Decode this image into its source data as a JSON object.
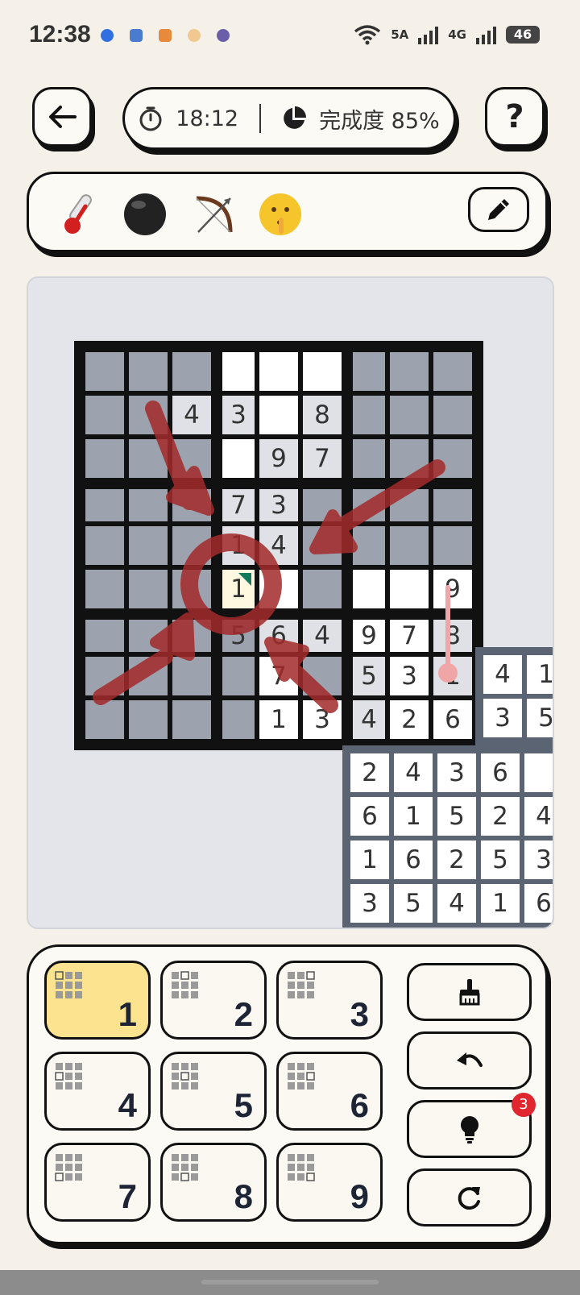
{
  "status_bar": {
    "time": "12:38",
    "net1": "5A",
    "net2": "4G",
    "battery": "46"
  },
  "header": {
    "back_icon": "arrow-left-icon",
    "timer": "18:12",
    "progress_text": "完成度 85%",
    "help_label": "?"
  },
  "tools": [
    "thermometer",
    "black-ball",
    "bow-and-arrow",
    "shushing-face"
  ],
  "board": {
    "main": [
      [
        "g",
        "g",
        "g",
        "w",
        "w",
        "w",
        "g",
        "g",
        "g"
      ],
      [
        "g",
        "g",
        "l:4",
        "l:3",
        "w",
        "l:8",
        "g",
        "g",
        "g"
      ],
      [
        "g",
        "g",
        "g",
        "w",
        "l:9",
        "l:7",
        "g",
        "g",
        "g"
      ],
      [
        "g",
        "g",
        "g",
        "l:7",
        "l:3",
        "g",
        "g",
        "g",
        "g"
      ],
      [
        "g",
        "g",
        "g",
        "l:1",
        "l:4",
        "g",
        "g",
        "g",
        "g"
      ],
      [
        "g",
        "g",
        "g",
        "y:1",
        "w",
        "g",
        "w",
        "w",
        "w:9"
      ],
      [
        "g",
        "g",
        "g",
        "g:5",
        "l:6",
        "l:4",
        "w:9",
        "w:7",
        "l:8"
      ],
      [
        "g",
        "g",
        "g",
        "g",
        "w:7",
        "g",
        "l:5",
        "w:3",
        "l:1"
      ],
      [
        "g",
        "g",
        "g",
        "g",
        "w:1",
        "w:3",
        "l:4",
        "w:2",
        "w:6"
      ]
    ],
    "second_visible": [
      [
        "w:4",
        "w:1"
      ],
      [
        "w:3",
        "w:5"
      ],
      [
        "w:2",
        "w:4",
        "w:3",
        "w:6",
        "w:"
      ],
      [
        "w:6",
        "w:1",
        "w:5",
        "w:2",
        "w:4"
      ],
      [
        "w:1",
        "w:6",
        "w:2",
        "w:5",
        "w:3"
      ],
      [
        "w:3",
        "w:5",
        "w:4",
        "w:1",
        "w:6"
      ]
    ]
  },
  "keypad": {
    "numbers": [
      "1",
      "2",
      "3",
      "4",
      "5",
      "6",
      "7",
      "8",
      "9"
    ],
    "selected": "1",
    "actions": [
      "brush-icon",
      "undo-icon",
      "hint-bulb-icon",
      "restart-icon"
    ],
    "hint_count": "3"
  },
  "colors": {
    "background": "#f5f1e8",
    "selected_key": "#fbe38f",
    "arrow_red": "#a52a2a",
    "hint_badge": "#e0262e"
  }
}
